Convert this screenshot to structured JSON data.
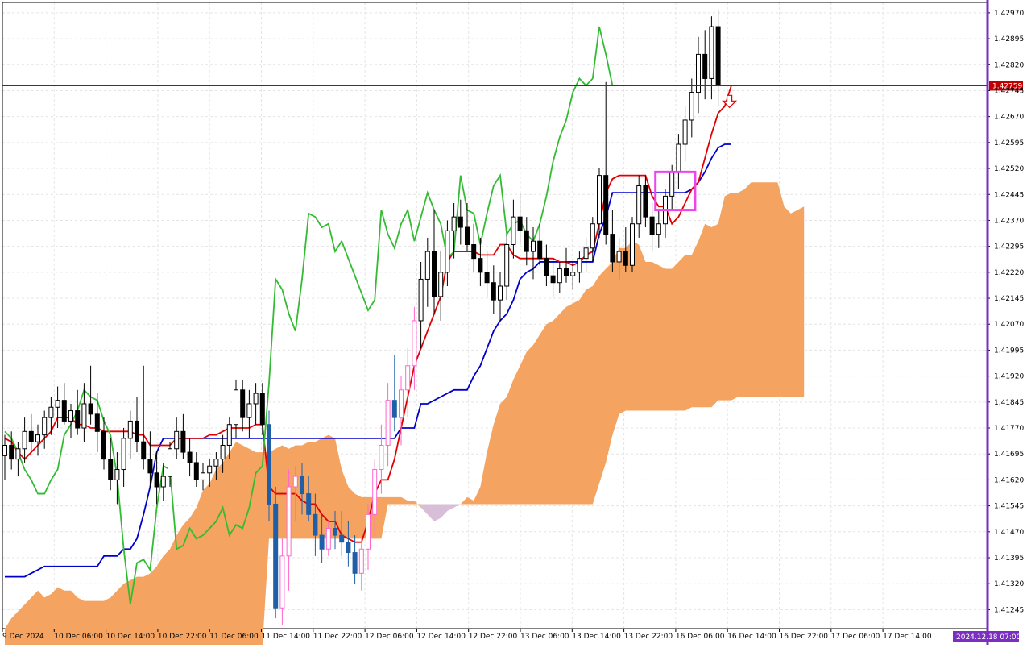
{
  "chart_data": {
    "type": "candlestick",
    "instrument_note": "",
    "y_ticks": [
      "1.42970",
      "1.42895",
      "1.42820",
      "1.42745",
      "1.42670",
      "1.42595",
      "1.42520",
      "1.42445",
      "1.42370",
      "1.42295",
      "1.42220",
      "1.42145",
      "1.42070",
      "1.41995",
      "1.41920",
      "1.41845",
      "1.41770",
      "1.41695",
      "1.41620",
      "1.41545",
      "1.41470",
      "1.41395",
      "1.41320",
      "1.41245"
    ],
    "ylim": [
      1.4119,
      1.43
    ],
    "x_ticks": [
      "9 Dec 2024",
      "10 Dec 06:00",
      "10 Dec 14:00",
      "10 Dec 22:00",
      "11 Dec 06:00",
      "11 Dec 14:00",
      "11 Dec 22:00",
      "12 Dec 06:00",
      "12 Dec 14:00",
      "12 Dec 22:00",
      "13 Dec 06:00",
      "13 Dec 14:00",
      "13 Dec 22:00",
      "16 Dec 06:00",
      "16 Dec 14:00",
      "16 Dec 22:00",
      "17 Dec 06:00",
      "17 Dec 14:00"
    ],
    "current_price": "1.42759",
    "current_time_label": "2024.12.18 07:00",
    "grid": true,
    "colors": {
      "tenkan": "#e00000",
      "kijun": "#0000cc",
      "chikou": "#33bb33",
      "cloud_bull": "#f4a460",
      "cloud_bear": "#d8bfd8",
      "price_line": "#c00000",
      "highlight_box": "#ee44ee",
      "axis_right": "#7a2fc0",
      "candle_up": "#ffffff",
      "candle_down": "#000000",
      "candle_up_hl": "#ff66cc",
      "candle_down_hl": "#1f5fa8"
    },
    "candles": [
      [
        1.4169,
        1.4175,
        1.4162,
        1.4172
      ],
      [
        1.4172,
        1.4176,
        1.4165,
        1.4168
      ],
      [
        1.4168,
        1.4173,
        1.4163,
        1.4171
      ],
      [
        1.4171,
        1.418,
        1.4167,
        1.4176
      ],
      [
        1.4176,
        1.4181,
        1.417,
        1.4173
      ],
      [
        1.4173,
        1.4178,
        1.4169,
        1.4175
      ],
      [
        1.4175,
        1.4182,
        1.4171,
        1.418
      ],
      [
        1.418,
        1.4186,
        1.4175,
        1.4183
      ],
      [
        1.4183,
        1.4189,
        1.4177,
        1.4185
      ],
      [
        1.4185,
        1.419,
        1.4178,
        1.4179
      ],
      [
        1.4179,
        1.4184,
        1.4174,
        1.4182
      ],
      [
        1.4182,
        1.4188,
        1.4175,
        1.4177
      ],
      [
        1.4177,
        1.419,
        1.4173,
        1.4184
      ],
      [
        1.4184,
        1.4195,
        1.4178,
        1.4181
      ],
      [
        1.4181,
        1.4187,
        1.417,
        1.4176
      ],
      [
        1.4176,
        1.418,
        1.4165,
        1.4168
      ],
      [
        1.4168,
        1.4174,
        1.4159,
        1.4162
      ],
      [
        1.4162,
        1.417,
        1.4155,
        1.4165
      ],
      [
        1.4165,
        1.4177,
        1.416,
        1.4174
      ],
      [
        1.4174,
        1.4182,
        1.4168,
        1.4179
      ],
      [
        1.4179,
        1.4186,
        1.417,
        1.4173
      ],
      [
        1.4173,
        1.4195,
        1.4165,
        1.4168
      ],
      [
        1.4168,
        1.4176,
        1.416,
        1.4164
      ],
      [
        1.4164,
        1.417,
        1.4155,
        1.416
      ],
      [
        1.416,
        1.4167,
        1.4156,
        1.4163
      ],
      [
        1.4163,
        1.4173,
        1.416,
        1.4171
      ],
      [
        1.4171,
        1.418,
        1.4168,
        1.4176
      ],
      [
        1.4176,
        1.4181,
        1.4168,
        1.417
      ],
      [
        1.417,
        1.4174,
        1.4163,
        1.4167
      ],
      [
        1.4167,
        1.417,
        1.416,
        1.4162
      ],
      [
        1.4162,
        1.4167,
        1.4159,
        1.4164
      ],
      [
        1.4164,
        1.4168,
        1.416,
        1.4166
      ],
      [
        1.4166,
        1.417,
        1.4162,
        1.4168
      ],
      [
        1.4168,
        1.4175,
        1.4164,
        1.4172
      ],
      [
        1.4172,
        1.418,
        1.4168,
        1.4178
      ],
      [
        1.4178,
        1.4191,
        1.4174,
        1.4188
      ],
      [
        1.4188,
        1.4191,
        1.4176,
        1.418
      ],
      [
        1.418,
        1.4188,
        1.4174,
        1.4184
      ],
      [
        1.4184,
        1.419,
        1.4178,
        1.4187
      ],
      [
        1.4187,
        1.419,
        1.4175,
        1.4178
      ],
      [
        1.4178,
        1.4182,
        1.415,
        1.4155
      ],
      [
        1.4155,
        1.416,
        1.4122,
        1.4125
      ],
      [
        1.4125,
        1.4145,
        1.412,
        1.414
      ],
      [
        1.414,
        1.4165,
        1.413,
        1.416
      ],
      [
        1.416,
        1.4166,
        1.415,
        1.4163
      ],
      [
        1.4163,
        1.4167,
        1.4152,
        1.4158
      ],
      [
        1.4158,
        1.4163,
        1.415,
        1.4152
      ],
      [
        1.4152,
        1.4158,
        1.414,
        1.4146
      ],
      [
        1.4146,
        1.4152,
        1.4138,
        1.4142
      ],
      [
        1.4142,
        1.415,
        1.414,
        1.4148
      ],
      [
        1.4148,
        1.4153,
        1.4142,
        1.4146
      ],
      [
        1.4146,
        1.4153,
        1.414,
        1.4144
      ],
      [
        1.4144,
        1.415,
        1.4137,
        1.4141
      ],
      [
        1.4141,
        1.4146,
        1.4132,
        1.4135
      ],
      [
        1.4135,
        1.4145,
        1.413,
        1.4142
      ],
      [
        1.4142,
        1.4155,
        1.4136,
        1.4152
      ],
      [
        1.4152,
        1.4168,
        1.4146,
        1.4165
      ],
      [
        1.4165,
        1.4178,
        1.4158,
        1.4172
      ],
      [
        1.4172,
        1.419,
        1.4166,
        1.4185
      ],
      [
        1.4185,
        1.4198,
        1.4176,
        1.418
      ],
      [
        1.418,
        1.4192,
        1.4172,
        1.4188
      ],
      [
        1.4188,
        1.42,
        1.418,
        1.4195
      ],
      [
        1.4195,
        1.4212,
        1.4188,
        1.4208
      ],
      [
        1.4208,
        1.4225,
        1.42,
        1.422
      ],
      [
        1.422,
        1.4232,
        1.4212,
        1.4228
      ],
      [
        1.4228,
        1.424,
        1.421,
        1.4215
      ],
      [
        1.4215,
        1.4228,
        1.4208,
        1.4222
      ],
      [
        1.4222,
        1.4237,
        1.4218,
        1.4234
      ],
      [
        1.4234,
        1.4242,
        1.4226,
        1.4238
      ],
      [
        1.4238,
        1.4243,
        1.423,
        1.4235
      ],
      [
        1.4235,
        1.4242,
        1.4228,
        1.423
      ],
      [
        1.423,
        1.4236,
        1.4222,
        1.4226
      ],
      [
        1.4226,
        1.4232,
        1.4218,
        1.4222
      ],
      [
        1.4222,
        1.4228,
        1.4215,
        1.4219
      ],
      [
        1.4219,
        1.4224,
        1.421,
        1.4214
      ],
      [
        1.4214,
        1.4222,
        1.4208,
        1.4218
      ],
      [
        1.4218,
        1.4233,
        1.4214,
        1.423
      ],
      [
        1.423,
        1.4243,
        1.4226,
        1.4238
      ],
      [
        1.4238,
        1.4245,
        1.423,
        1.4234
      ],
      [
        1.4234,
        1.4238,
        1.4224,
        1.4228
      ],
      [
        1.4228,
        1.4235,
        1.422,
        1.4231
      ],
      [
        1.4231,
        1.4236,
        1.4224,
        1.4226
      ],
      [
        1.4226,
        1.423,
        1.4218,
        1.4221
      ],
      [
        1.4221,
        1.4226,
        1.4215,
        1.4219
      ],
      [
        1.4219,
        1.4225,
        1.4216,
        1.4223
      ],
      [
        1.4223,
        1.4229,
        1.4219,
        1.4221
      ],
      [
        1.4221,
        1.4225,
        1.4217,
        1.4222
      ],
      [
        1.4222,
        1.4228,
        1.4219,
        1.4226
      ],
      [
        1.4226,
        1.4232,
        1.4222,
        1.4229
      ],
      [
        1.4229,
        1.4238,
        1.4225,
        1.4236
      ],
      [
        1.4236,
        1.4252,
        1.4232,
        1.425
      ],
      [
        1.425,
        1.4277,
        1.423,
        1.4233
      ],
      [
        1.4233,
        1.424,
        1.4222,
        1.4225
      ],
      [
        1.4225,
        1.4232,
        1.422,
        1.4228
      ],
      [
        1.4228,
        1.4235,
        1.4222,
        1.4224
      ],
      [
        1.4224,
        1.4238,
        1.4222,
        1.4236
      ],
      [
        1.4236,
        1.425,
        1.4232,
        1.4247
      ],
      [
        1.4247,
        1.425,
        1.4235,
        1.4238
      ],
      [
        1.4238,
        1.4242,
        1.4228,
        1.4233
      ],
      [
        1.4233,
        1.424,
        1.4229,
        1.4236
      ],
      [
        1.4236,
        1.4246,
        1.4232,
        1.4244
      ],
      [
        1.4244,
        1.4253,
        1.424,
        1.4251
      ],
      [
        1.4251,
        1.4262,
        1.4246,
        1.4259
      ],
      [
        1.4259,
        1.427,
        1.4254,
        1.4266
      ],
      [
        1.4266,
        1.4278,
        1.4261,
        1.4274
      ],
      [
        1.4274,
        1.429,
        1.4268,
        1.4285
      ],
      [
        1.4285,
        1.4292,
        1.4272,
        1.4278
      ],
      [
        1.4278,
        1.4296,
        1.4272,
        1.4293
      ],
      [
        1.4293,
        1.4298,
        1.427,
        1.4276
      ]
    ],
    "tenkan": [
      1.4174,
      1.4173,
      1.417,
      1.4168,
      1.417,
      1.4172,
      1.4174,
      1.4176,
      1.418,
      1.418,
      1.418,
      1.4178,
      1.4178,
      1.4177,
      1.4177,
      1.4176,
      1.4176,
      1.4176,
      1.4176,
      1.4176,
      1.4175,
      1.4175,
      1.4172,
      1.4172,
      1.4172,
      1.4172,
      1.4174,
      1.4174,
      1.4174,
      1.4174,
      1.4174,
      1.4175,
      1.4175,
      1.4176,
      1.4177,
      1.4177,
      1.4177,
      1.4177,
      1.4178,
      1.4178,
      1.416,
      1.4158,
      1.4158,
      1.4158,
      1.4158,
      1.4156,
      1.4155,
      1.4155,
      1.4152,
      1.415,
      1.415,
      1.4146,
      1.4145,
      1.4144,
      1.4144,
      1.415,
      1.4158,
      1.4162,
      1.4162,
      1.4168,
      1.4177,
      1.4186,
      1.4195,
      1.42,
      1.4205,
      1.421,
      1.4215,
      1.4225,
      1.4228,
      1.4228,
      1.4228,
      1.4228,
      1.4227,
      1.4227,
      1.4227,
      1.423,
      1.423,
      1.4227,
      1.4226,
      1.4226,
      1.4226,
      1.4226,
      1.4226,
      1.4226,
      1.4225,
      1.4225,
      1.4224,
      1.4225,
      1.4227,
      1.4228,
      1.4236,
      1.4245,
      1.4249,
      1.425,
      1.425,
      1.425,
      1.425,
      1.425,
      1.4244,
      1.4241,
      1.4241,
      1.4236,
      1.4238,
      1.4242,
      1.4246,
      1.4248,
      1.4255,
      1.4262,
      1.4268,
      1.427,
      1.4276
    ],
    "kijun": [
      1.4134,
      1.4134,
      1.4134,
      1.4134,
      1.4135,
      1.4136,
      1.4137,
      1.4137,
      1.4137,
      1.4137,
      1.4137,
      1.4137,
      1.4137,
      1.4137,
      1.4137,
      1.414,
      1.414,
      1.414,
      1.4142,
      1.4142,
      1.4145,
      1.4152,
      1.416,
      1.417,
      1.4174,
      1.4174,
      1.4174,
      1.4174,
      1.4174,
      1.4174,
      1.4174,
      1.4174,
      1.4174,
      1.4174,
      1.4174,
      1.4174,
      1.4174,
      1.4174,
      1.4174,
      1.4174,
      1.4174,
      1.4174,
      1.4174,
      1.4174,
      1.4174,
      1.4174,
      1.4174,
      1.4174,
      1.4174,
      1.4174,
      1.4174,
      1.4174,
      1.4174,
      1.4174,
      1.4174,
      1.4174,
      1.4174,
      1.4174,
      1.4174,
      1.4174,
      1.4177,
      1.4177,
      1.4177,
      1.4184,
      1.4184,
      1.4185,
      1.4186,
      1.4187,
      1.4188,
      1.4188,
      1.4188,
      1.4192,
      1.4195,
      1.42,
      1.4205,
      1.4208,
      1.421,
      1.4214,
      1.422,
      1.4222,
      1.4223,
      1.4225,
      1.4225,
      1.4225,
      1.4225,
      1.4225,
      1.4225,
      1.4225,
      1.4225,
      1.4225,
      1.4233,
      1.4238,
      1.4245,
      1.4245,
      1.4245,
      1.4245,
      1.4245,
      1.4245,
      1.4245,
      1.4245,
      1.4245,
      1.4245,
      1.4245,
      1.4245,
      1.4246,
      1.4248,
      1.4251,
      1.4255,
      1.4258,
      1.4259,
      1.4259
    ],
    "chikou": [
      1.4176,
      1.4174,
      1.417,
      1.4165,
      1.4162,
      1.4158,
      1.4158,
      1.4162,
      1.4165,
      1.4175,
      1.4178,
      1.4182,
      1.4188,
      1.4186,
      1.4185,
      1.4179,
      1.4175,
      1.4163,
      1.4142,
      1.4126,
      1.4138,
      1.4139,
      1.4136,
      1.4154,
      1.4166,
      1.4165,
      1.4142,
      1.4143,
      1.4148,
      1.4145,
      1.4146,
      1.4148,
      1.415,
      1.4154,
      1.4146,
      1.4149,
      1.4148,
      1.4154,
      1.4164,
      1.4166,
      1.419,
      1.422,
      1.4217,
      1.421,
      1.4205,
      1.422,
      1.4239,
      1.4238,
      1.4235,
      1.4236,
      1.4228,
      1.4231,
      1.4226,
      1.4221,
      1.4216,
      1.4211,
      1.4214,
      1.424,
      1.4233,
      1.4229,
      1.4236,
      1.424,
      1.4231,
      1.4238,
      1.4245,
      1.424,
      1.4236,
      1.4226,
      1.4228,
      1.425,
      1.424,
      1.4239,
      1.423,
      1.4239,
      1.4247,
      1.425,
      1.4233,
      1.4236,
      1.4237,
      1.4233,
      1.4231,
      1.4236,
      1.4244,
      1.4254,
      1.4261,
      1.4266,
      1.4274,
      1.4278,
      1.4276,
      1.4278,
      1.4293,
      1.4285,
      1.4276
    ],
    "span_a": [
      1.4119,
      1.4122,
      1.4124,
      1.4126,
      1.4128,
      1.413,
      1.4128,
      1.4129,
      1.4131,
      1.413,
      1.413,
      1.4128,
      1.4127,
      1.4127,
      1.4127,
      1.4127,
      1.4128,
      1.413,
      1.4132,
      1.4133,
      1.4134,
      1.4134,
      1.4135,
      1.4137,
      1.414,
      1.4142,
      1.4146,
      1.4149,
      1.4151,
      1.4154,
      1.4159,
      1.4161,
      1.4165,
      1.4167,
      1.417,
      1.4173,
      1.4172,
      1.4171,
      1.417,
      1.417,
      1.417,
      1.4171,
      1.4172,
      1.4171,
      1.4172,
      1.4172,
      1.4173,
      1.4173,
      1.4174,
      1.4175,
      1.4174,
      1.4165,
      1.416,
      1.4158,
      1.4157,
      1.4157,
      1.4157,
      1.4157,
      1.4157,
      1.4157,
      1.4157,
      1.4156,
      1.4156,
      1.4154,
      1.4152,
      1.415,
      1.4151,
      1.4153,
      1.4154,
      1.4155,
      1.4157,
      1.4156,
      1.416,
      1.417,
      1.4178,
      1.4184,
      1.4186,
      1.4191,
      1.4195,
      1.4199,
      1.4201,
      1.4204,
      1.4207,
      1.4208,
      1.421,
      1.4212,
      1.4213,
      1.4214,
      1.4217,
      1.4218,
      1.4221,
      1.4223,
      1.4225,
      1.4229,
      1.4229,
      1.4231,
      1.423,
      1.4225,
      1.4225,
      1.4224,
      1.4223,
      1.4223,
      1.4225,
      1.4227,
      1.4227,
      1.4231,
      1.4236,
      1.4235,
      1.4236,
      1.4244,
      1.4245,
      1.4245,
      1.4246,
      1.4248,
      1.4248,
      1.4248,
      1.4248,
      1.4248,
      1.4241,
      1.4239,
      1.424,
      1.4241
    ],
    "span_b": [
      1.4114,
      1.4114,
      1.4114,
      1.4114,
      1.4114,
      1.4114,
      1.4114,
      1.4114,
      1.4114,
      1.4114,
      1.4114,
      1.4114,
      1.4114,
      1.4114,
      1.4114,
      1.4114,
      1.4114,
      1.4114,
      1.4114,
      1.4114,
      1.4114,
      1.4114,
      1.4114,
      1.4114,
      1.4114,
      1.4114,
      1.4114,
      1.4114,
      1.4114,
      1.4114,
      1.4114,
      1.4114,
      1.4114,
      1.4114,
      1.4114,
      1.4114,
      1.4114,
      1.4114,
      1.4114,
      1.4114,
      1.4145,
      1.4145,
      1.4145,
      1.4145,
      1.4145,
      1.4145,
      1.4145,
      1.4145,
      1.4145,
      1.4145,
      1.4145,
      1.4145,
      1.4145,
      1.4145,
      1.4145,
      1.4145,
      1.4145,
      1.4145,
      1.4155,
      1.4155,
      1.4155,
      1.4155,
      1.4155,
      1.4155,
      1.4155,
      1.4155,
      1.4155,
      1.4155,
      1.4155,
      1.4155,
      1.4155,
      1.4155,
      1.4155,
      1.4155,
      1.4155,
      1.4155,
      1.4155,
      1.4155,
      1.4155,
      1.4155,
      1.4155,
      1.4155,
      1.4155,
      1.4155,
      1.4155,
      1.4155,
      1.4155,
      1.4155,
      1.4155,
      1.4155,
      1.4161,
      1.4167,
      1.4175,
      1.4181,
      1.4182,
      1.4182,
      1.4182,
      1.4182,
      1.4182,
      1.4182,
      1.4182,
      1.4182,
      1.4182,
      1.4182,
      1.4183,
      1.4183,
      1.4183,
      1.4183,
      1.4185,
      1.4185,
      1.4185,
      1.4186,
      1.4186,
      1.4186,
      1.4186,
      1.4186,
      1.4186,
      1.4186,
      1.4186,
      1.4186,
      1.4186,
      1.4186,
      1.4186,
      1.4186,
      1.4186
    ],
    "highlight_box": {
      "x_from": 98.5,
      "x_to": 104.5,
      "y_from": 1.424,
      "y_to": 1.4251
    },
    "signal": "down-arrow"
  }
}
